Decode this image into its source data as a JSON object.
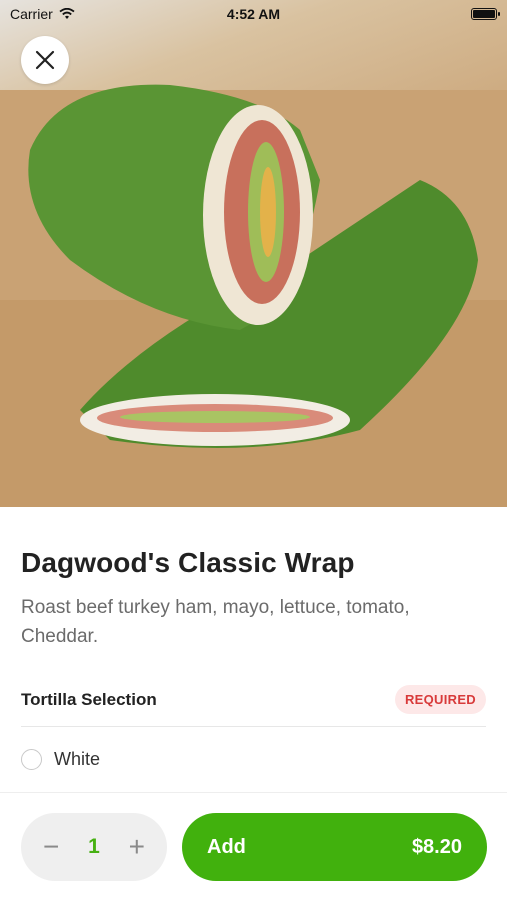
{
  "status_bar": {
    "carrier": "Carrier",
    "time": "4:52 AM"
  },
  "hero": {
    "image_subject": "spinach-wrap-photo"
  },
  "item": {
    "title": "Dagwood's Classic Wrap",
    "description": "Roast beef turkey ham, mayo, lettuce, tomato, Cheddar."
  },
  "options_section": {
    "title": "Tortilla Selection",
    "badge": "REQUIRED",
    "options": [
      {
        "label": "White",
        "selected": false
      }
    ]
  },
  "order": {
    "quantity": "1",
    "decrement_symbol": "−",
    "increment_symbol": "+",
    "add_label": "Add",
    "price": "$8.20"
  },
  "colors": {
    "accent_green": "#41b10d",
    "quantity_green": "#46b012",
    "required_red": "#d83a3a",
    "required_bg": "#fde8e8"
  }
}
